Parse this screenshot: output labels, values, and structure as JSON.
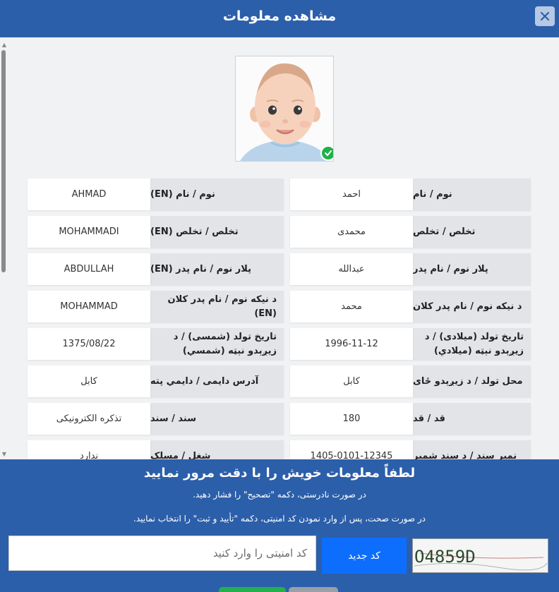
{
  "header": {
    "title": "مشاهده معلومات",
    "close_icon": "close-icon"
  },
  "rows": [
    {
      "label_fa": "نوم / نام",
      "value_fa": "احمد",
      "label_en": "نوم / نام (EN)",
      "value_en": "AHMAD"
    },
    {
      "label_fa": "تخلص / تخلص",
      "value_fa": "محمدی",
      "label_en": "تخلص / تخلص (EN)",
      "value_en": "MOHAMMADI"
    },
    {
      "label_fa": "پلار نوم / نام پدر",
      "value_fa": "عبدالله",
      "label_en": "پلار نوم / نام پدر (EN)",
      "value_en": "ABDULLAH"
    },
    {
      "label_fa": "د نیکه نوم / نام پدر کلان",
      "value_fa": "محمد",
      "label_en": "د نیکه نوم / نام پدر کلان (EN)",
      "value_en": "MOHAMMAD"
    },
    {
      "label_fa": "تاریخ تولد (میلادی) / د زیږېدو نېټه (میلادي)",
      "value_fa": "1996-11-12",
      "label_en": "تاریخ تولد (شمسی) / د زیږېدو نېټه (شمسي)",
      "value_en": "1375/08/22"
    },
    {
      "label_fa": "محل تولد / د زیږېدو ځای",
      "value_fa": "کابل",
      "label_en": "آدرس دایمی / دایمي پته",
      "value_en": "کابل"
    },
    {
      "label_fa": "قد / قد",
      "value_fa": "180",
      "label_en": "سند / سند",
      "value_en": "تذکره الکترونیکی"
    },
    {
      "label_fa": "نمبر سند / د سند شمیر",
      "value_fa": "1405-0101-12345",
      "label_en": "شغل / مسلک",
      "value_en": "ندارد"
    }
  ],
  "footer": {
    "title": "لطفاً معلومات خویش را با دقت مرور نمایید",
    "line1": "در صورت نادرستی، دکمه \"تصحیح\" را فشار دهید.",
    "line2": "در صورت صحت، پس از وارد نمودن کد امنیتی، دکمه \"تأیید و ثبت\" را انتخاب نمایید.",
    "security_placeholder": "کد امنیتی را وارد کنید",
    "new_code_label": "کد جدید",
    "captcha_text": "O4859D"
  },
  "colors": {
    "brand": "#2c5faa",
    "primary_button": "#0d6efd",
    "verified": "#22b04b"
  }
}
